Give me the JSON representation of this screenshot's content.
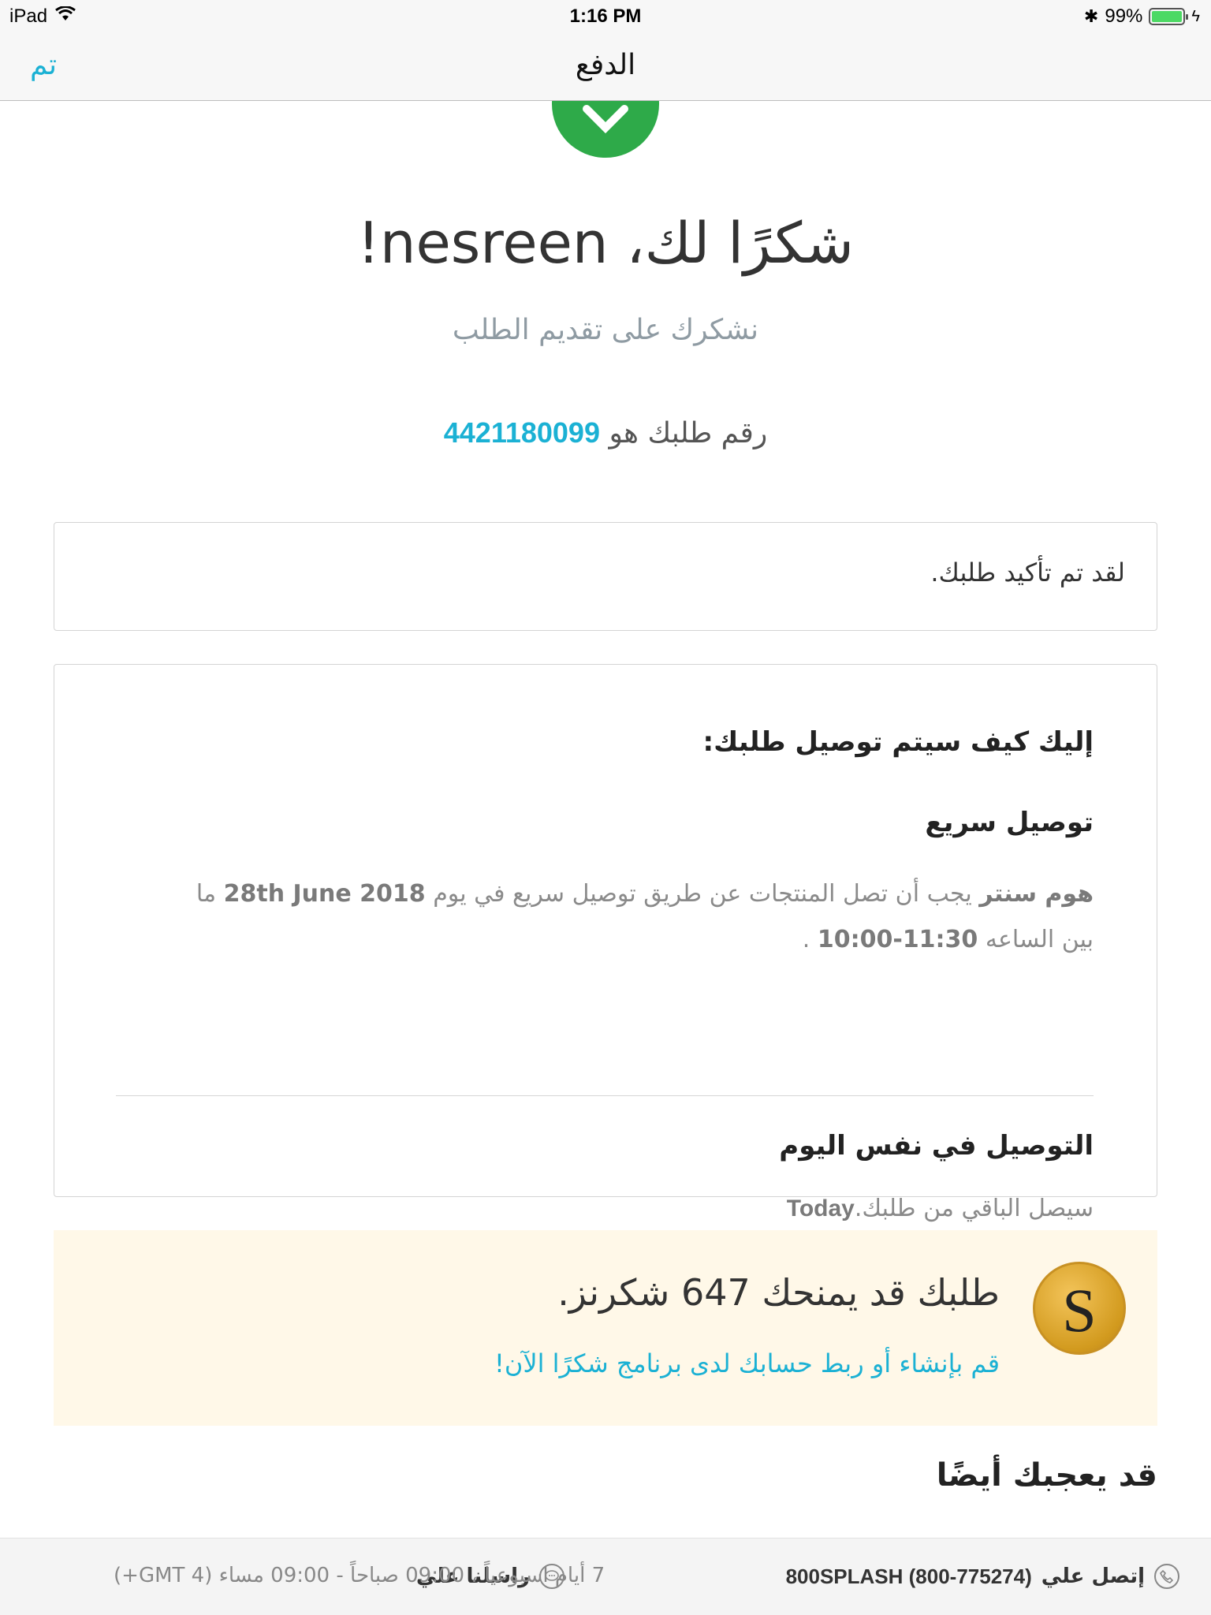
{
  "status_bar": {
    "device": "iPad",
    "time": "1:16 PM",
    "battery": "99%"
  },
  "nav": {
    "title": "الدفع",
    "done": "تم"
  },
  "thanks": {
    "title": "شكرًا لك، nesreen!",
    "subtitle": "نشكرك على تقديم الطلب",
    "order_prefix": "رقم طلبك هو",
    "order_number": "4421180099"
  },
  "confirmation": {
    "message": "لقد تم تأكيد طلبك."
  },
  "delivery": {
    "heading": "إليك كيف سيتم توصيل طلبك:",
    "fast_title": "توصيل سريع",
    "fast_store": "هوم سنتر",
    "fast_text_1": "يجب أن تصل المنتجات عن طريق توصيل سريع في يوم",
    "fast_date": "28th June 2018",
    "fast_text_2": "ما بين الساعه",
    "fast_time": "11:30-10:00",
    "fast_end": ".",
    "same_title": "التوصيل في نفس اليوم",
    "same_text": "سيصل الباقي من طلبك.",
    "same_when": "Today"
  },
  "rewards": {
    "title": "طلبك قد يمنحك 647 شكرنز.",
    "link": "قم بإنشاء أو ربط حسابك لدى برنامج شكرًا الآن!",
    "coin_letter": "S"
  },
  "also_like": "قد يعجبك أيضًا",
  "footer": {
    "call_label": "إتصل علي",
    "call_number": "800SPLASH (800-775274)",
    "message_label": "راسلنا علي",
    "hours": "7 أيام اسبوعياً ، 09:00 صباحاً - 09:00 مساء (GMT 4+)"
  },
  "colors": {
    "accent": "#1bb1d4",
    "success": "#2eaa49",
    "rewards_bg": "#fff8e8"
  }
}
